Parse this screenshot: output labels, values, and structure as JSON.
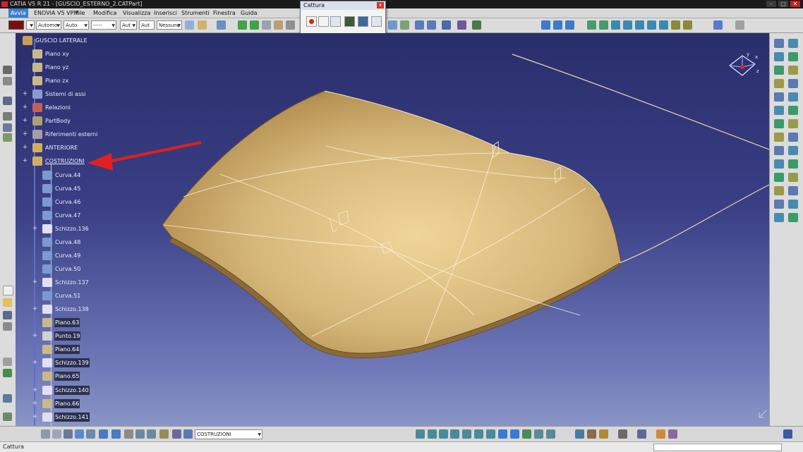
{
  "window": {
    "title": "CATIA V5 R 21 - [GUSCIO_ESTERNO_2.CATPart]",
    "min": "–",
    "max": "□",
    "close": "✕"
  },
  "menu": [
    "Avvia",
    "ENOVIA V5 VPM",
    "File",
    "Modifica",
    "Visualizza",
    "Inserisci",
    "Strumenti",
    "Finestra",
    "Guida"
  ],
  "toolbar": {
    "color": "#7a0e0e",
    "transparency": "Automo",
    "linetype": "Auto",
    "linestyle": "-----",
    "thickness": "Aut",
    "pointstyle": "Aut",
    "layer": "Nessuno"
  },
  "capture_window": {
    "title": "Cattura",
    "close": "x"
  },
  "tree": {
    "root": "GUSCIO LATERALE",
    "items": [
      {
        "label": "Piano xy",
        "icon": "plane-icon",
        "dark": false
      },
      {
        "label": "Piano yz",
        "icon": "plane-icon",
        "dark": false
      },
      {
        "label": "Piano zx",
        "icon": "plane-icon",
        "dark": false
      },
      {
        "label": "Sistemi di assi",
        "icon": "axis-system-icon",
        "dark": false
      },
      {
        "label": "Relazioni",
        "icon": "relations-icon",
        "dark": false
      },
      {
        "label": "PartBody",
        "icon": "partbody-icon",
        "dark": false
      },
      {
        "label": "Riferimenti esterni",
        "icon": "external-refs-icon",
        "dark": false
      },
      {
        "label": "ANTERIORE",
        "icon": "geometric-set-icon",
        "dark": false
      },
      {
        "label": "COSTRUZIONI",
        "icon": "geometric-set-icon",
        "dark": false
      },
      {
        "label": "Curva.44",
        "icon": "curve-icon",
        "dark": false
      },
      {
        "label": "Curva.45",
        "icon": "curve-icon",
        "dark": false
      },
      {
        "label": "Curva.46",
        "icon": "curve-icon",
        "dark": false
      },
      {
        "label": "Curva.47",
        "icon": "curve-icon",
        "dark": false
      },
      {
        "label": "Schizzo.136",
        "icon": "sketch-icon",
        "dark": false
      },
      {
        "label": "Curva.48",
        "icon": "curve-icon",
        "dark": false
      },
      {
        "label": "Curva.49",
        "icon": "curve-icon",
        "dark": false
      },
      {
        "label": "Curva.50",
        "icon": "curve-icon",
        "dark": false
      },
      {
        "label": "Schizzo.137",
        "icon": "sketch-icon",
        "dark": false
      },
      {
        "label": "Curva.51",
        "icon": "curve-icon",
        "dark": false
      },
      {
        "label": "Schizzo.138",
        "icon": "sketch-icon",
        "dark": false
      },
      {
        "label": "Piano.63",
        "icon": "plane-icon",
        "dark": true
      },
      {
        "label": "Punto.19",
        "icon": "point-icon",
        "dark": true
      },
      {
        "label": "Piano.64",
        "icon": "plane-icon",
        "dark": true
      },
      {
        "label": "Schizzo.139",
        "icon": "sketch-icon",
        "dark": true
      },
      {
        "label": "Piano.65",
        "icon": "plane-icon",
        "dark": true
      },
      {
        "label": "Schizzo.140",
        "icon": "sketch-icon",
        "dark": true
      },
      {
        "label": "Piano.66",
        "icon": "plane-icon",
        "dark": true
      },
      {
        "label": "Schizzo.141",
        "icon": "sketch-icon",
        "dark": true
      }
    ]
  },
  "bottom": {
    "current_set": "COSTRUZIONI"
  },
  "status": {
    "text": "Cattura"
  },
  "colors": {
    "surface": "#d9b97c",
    "arrow": "#e02020",
    "tree_trunk": "#5a6fd0"
  }
}
